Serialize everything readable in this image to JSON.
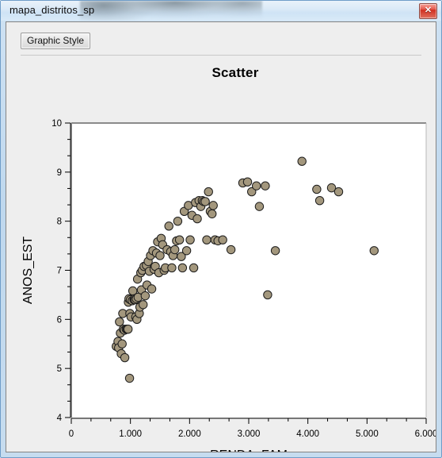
{
  "window": {
    "title": "mapa_distritos_sp",
    "close_label": "✕",
    "close_icon": "close-icon"
  },
  "toolbar": {
    "graphic_style_label": "Graphic Style"
  },
  "chart_data": {
    "type": "scatter",
    "title": "Scatter",
    "xlabel": "RENDA_FAM",
    "ylabel": "ANOS_EST",
    "xlim": [
      0,
      6000
    ],
    "ylim": [
      4,
      10
    ],
    "grid": false,
    "legend": "none",
    "xticks": [
      0,
      1000,
      2000,
      3000,
      4000,
      5000,
      6000
    ],
    "xtick_labels": [
      "0",
      "1.000",
      "2.000",
      "3.000",
      "4.000",
      "5.000",
      "6.000"
    ],
    "yticks": [
      4,
      5,
      6,
      7,
      8,
      9,
      10
    ],
    "ytick_labels": [
      "4",
      "5",
      "6",
      "7",
      "8",
      "9",
      "10"
    ],
    "x_minor_per_major": 2,
    "y_minor_per_major": 2,
    "marker": {
      "shape": "circle",
      "fill": "#a3977d",
      "edge": "#1c1c1c",
      "size": 5.2
    },
    "point_count": 96,
    "points": [
      [
        760,
        5.45
      ],
      [
        790,
        5.55
      ],
      [
        800,
        5.42
      ],
      [
        815,
        5.95
      ],
      [
        830,
        5.72
      ],
      [
        845,
        5.3
      ],
      [
        860,
        5.5
      ],
      [
        870,
        6.12
      ],
      [
        880,
        5.8
      ],
      [
        900,
        5.78
      ],
      [
        905,
        5.22
      ],
      [
        930,
        5.8
      ],
      [
        945,
        5.8
      ],
      [
        960,
        5.8
      ],
      [
        965,
        6.35
      ],
      [
        975,
        6.42
      ],
      [
        985,
        4.8
      ],
      [
        990,
        6.12
      ],
      [
        1000,
        6.4
      ],
      [
        1010,
        6.05
      ],
      [
        1030,
        6.38
      ],
      [
        1040,
        6.58
      ],
      [
        1060,
        6.4
      ],
      [
        1070,
        6.42
      ],
      [
        1080,
        6.4
      ],
      [
        1090,
        6.05
      ],
      [
        1100,
        6.42
      ],
      [
        1110,
        6.0
      ],
      [
        1120,
        6.82
      ],
      [
        1130,
        6.45
      ],
      [
        1150,
        6.12
      ],
      [
        1160,
        6.25
      ],
      [
        1175,
        6.95
      ],
      [
        1185,
        6.6
      ],
      [
        1200,
        7.0
      ],
      [
        1215,
        6.3
      ],
      [
        1230,
        7.08
      ],
      [
        1250,
        6.48
      ],
      [
        1270,
        7.1
      ],
      [
        1280,
        6.7
      ],
      [
        1300,
        7.18
      ],
      [
        1320,
        6.98
      ],
      [
        1340,
        7.3
      ],
      [
        1360,
        6.62
      ],
      [
        1380,
        7.4
      ],
      [
        1400,
        7.02
      ],
      [
        1420,
        7.08
      ],
      [
        1440,
        7.35
      ],
      [
        1460,
        7.58
      ],
      [
        1480,
        6.95
      ],
      [
        1500,
        7.3
      ],
      [
        1520,
        7.65
      ],
      [
        1545,
        7.52
      ],
      [
        1570,
        7.0
      ],
      [
        1590,
        7.05
      ],
      [
        1620,
        7.42
      ],
      [
        1650,
        7.9
      ],
      [
        1680,
        7.38
      ],
      [
        1700,
        7.05
      ],
      [
        1720,
        7.3
      ],
      [
        1750,
        7.42
      ],
      [
        1780,
        7.6
      ],
      [
        1800,
        8.0
      ],
      [
        1830,
        7.62
      ],
      [
        1860,
        7.28
      ],
      [
        1880,
        7.05
      ],
      [
        1910,
        8.2
      ],
      [
        1950,
        7.4
      ],
      [
        1980,
        8.32
      ],
      [
        2010,
        7.62
      ],
      [
        2040,
        8.12
      ],
      [
        2070,
        7.05
      ],
      [
        2100,
        8.38
      ],
      [
        2130,
        8.05
      ],
      [
        2160,
        8.42
      ],
      [
        2190,
        8.3
      ],
      [
        2215,
        8.42
      ],
      [
        2240,
        8.4
      ],
      [
        2265,
        8.4
      ],
      [
        2290,
        7.62
      ],
      [
        2320,
        8.6
      ],
      [
        2350,
        8.2
      ],
      [
        2380,
        8.15
      ],
      [
        2400,
        8.32
      ],
      [
        2430,
        7.62
      ],
      [
        2480,
        7.6
      ],
      [
        2560,
        7.62
      ],
      [
        2700,
        7.42
      ],
      [
        2900,
        8.78
      ],
      [
        2980,
        8.8
      ],
      [
        3050,
        8.6
      ],
      [
        3130,
        8.72
      ],
      [
        3180,
        8.3
      ],
      [
        3280,
        8.72
      ],
      [
        3320,
        6.5
      ],
      [
        3450,
        7.4
      ],
      [
        3900,
        9.22
      ],
      [
        4150,
        8.65
      ],
      [
        4200,
        8.42
      ],
      [
        4400,
        8.68
      ],
      [
        4520,
        8.6
      ],
      [
        5120,
        7.4
      ]
    ]
  }
}
